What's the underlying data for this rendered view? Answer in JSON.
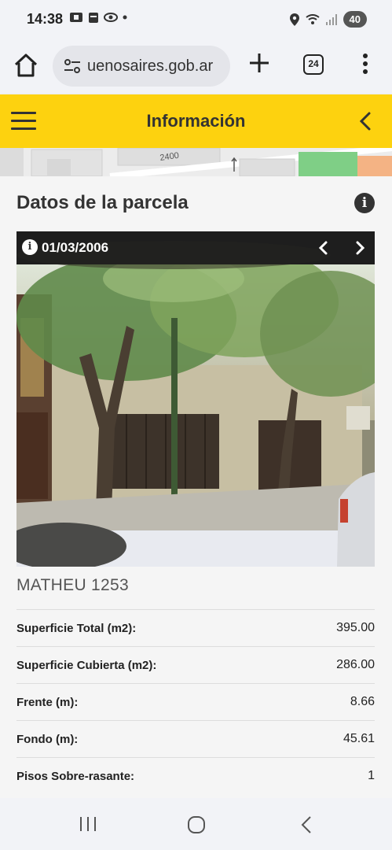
{
  "status_bar": {
    "time": "14:38",
    "battery": "40"
  },
  "browser": {
    "url": "uenosaires.gob.ar",
    "tab_count": "24"
  },
  "header": {
    "title": "Información"
  },
  "map": {
    "street_number": "2400"
  },
  "parcel": {
    "section_title": "Datos de la parcela",
    "photo_date": "01/03/2006",
    "address": "MATHEU 1253",
    "rows": [
      {
        "label": "Superficie Total (m2):",
        "value": "395.00"
      },
      {
        "label": "Superficie Cubierta (m2):",
        "value": "286.00"
      },
      {
        "label": "Frente (m):",
        "value": "8.66"
      },
      {
        "label": "Fondo (m):",
        "value": "45.61"
      },
      {
        "label": "Pisos Sobre-rasante:",
        "value": "1"
      }
    ]
  },
  "colors": {
    "header_yellow": "#fdd20f",
    "text_dark": "#333333"
  },
  "icons": {
    "home": "home-icon",
    "url_settings": "tune-icon",
    "new_tab": "plus-icon",
    "overflow": "more-vert-icon",
    "menu": "hamburger-icon",
    "back": "chevron-left-icon",
    "info": "info-icon"
  }
}
